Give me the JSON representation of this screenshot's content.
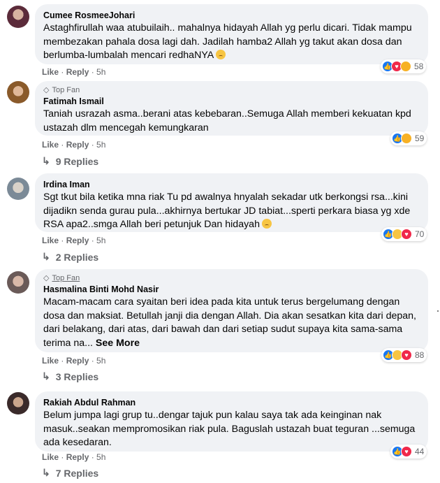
{
  "comments": [
    {
      "author": "Cumee RosmeeJohari",
      "top_fan": "",
      "lines": [
        "Astaghfirullah waa atubuilaih.. mahalnya hidayah Allah yg perlu dicari. Tidak mampu",
        "membezakan pahala dosa lagi dah. Jadilah hamba2 Allah yg takut akan dosa dan",
        "berlumba-lumbalah mencari redhaNYA"
      ],
      "like": "Like",
      "reply": "Reply",
      "time": "5h",
      "reactions": [
        "like-icon",
        "love-icon",
        "care-icon"
      ],
      "reaction_count": "58",
      "replies": ""
    },
    {
      "author": "Fatimah Ismail",
      "top_fan": "Top Fan",
      "lines": [
        "Taniah usrazah asma..berani atas kebebaran..Semuga Allah memberi kekuatan kpd",
        "ustazah dlm mencegah kemungkaran"
      ],
      "like": "Like",
      "reply": "Reply",
      "time": "5h",
      "reactions": [
        "like-icon",
        "care-icon"
      ],
      "reaction_count": "59",
      "replies": "9 Replies"
    },
    {
      "author": "Irdina Iman",
      "top_fan": "",
      "lines": [
        "Sgt tkut bila ketika mna riak Tu pd awalnya hnyalah sekadar utk berkongsi rsa...kini",
        "dijadikn senda gurau pula...akhirnya bertukar JD tabiat...sperti perkara biasa yg xde",
        "RSA apa2..smga Allah beri petunjuk Dan hidayah"
      ],
      "like": "Like",
      "reply": "Reply",
      "time": "5h",
      "reactions": [
        "like-icon",
        "sad-icon",
        "love-icon"
      ],
      "reaction_count": "70",
      "replies": "2 Replies"
    },
    {
      "author": "Hasmalina Binti Mohd Nasir",
      "top_fan": "Top Fan",
      "lines": [
        "Macam-macam cara syaitan beri idea pada kita untuk terus bergelumang dengan",
        "dosa dan maksiat. Betullah janji dia dengan Allah. Dia akan sesatkan kita dari depan,",
        "dari belakang, dari atas, dari bawah dan dari setiap sudut supaya kita sama-sama",
        "terima na..."
      ],
      "see_more": "See More",
      "like": "Like",
      "reply": "Reply",
      "time": "5h",
      "reactions": [
        "like-icon",
        "sad-icon",
        "love-icon"
      ],
      "reaction_count": "88",
      "replies": "3 Replies"
    },
    {
      "author": "Rakiah Abdul Rahman",
      "top_fan": "",
      "lines": [
        "Belum jumpa lagi grup tu..dengar tajuk pun kalau saya tak ada keinginan nak",
        "masuk..seakan mempromosikan riak pula. Baguslah ustazah buat teguran ...semuga",
        "ada kesedaran."
      ],
      "like": "Like",
      "reply": "Reply",
      "time": "5h",
      "reactions": [
        "like-icon",
        "love-icon"
      ],
      "reaction_count": "44",
      "replies": "7 Replies"
    }
  ],
  "colors": {
    "bubble": "#f0f2f5",
    "like_blue": "#1877f2",
    "love_red": "#f0284a",
    "care_yellow": "#f7b125",
    "secondary_text": "#65676b"
  }
}
